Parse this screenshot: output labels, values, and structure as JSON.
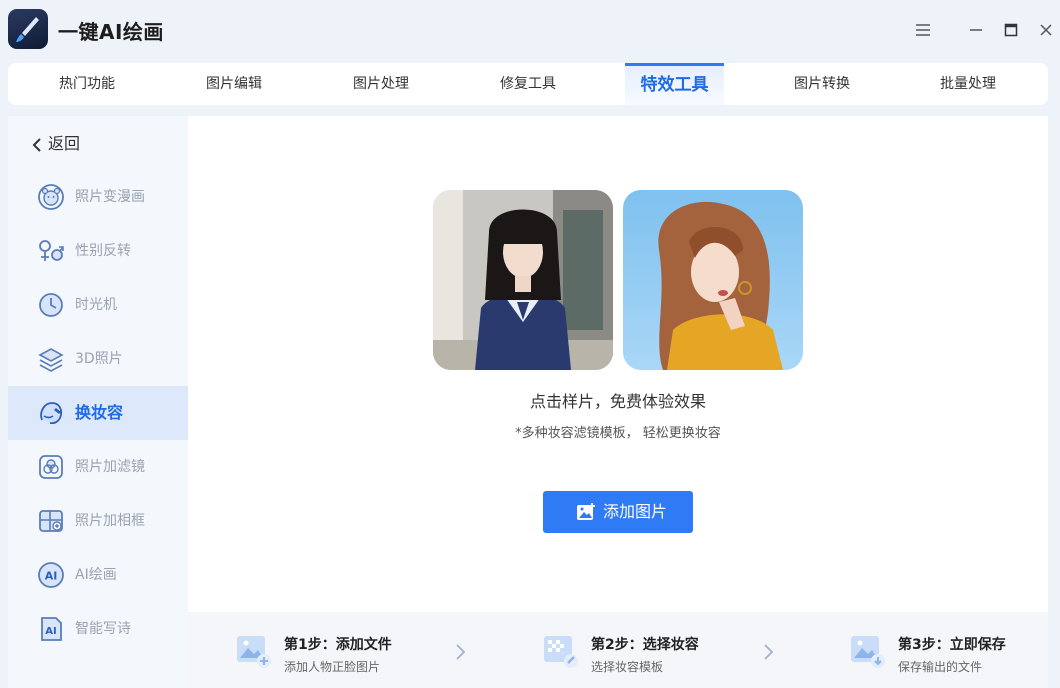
{
  "app": {
    "title": "一键AI绘画"
  },
  "tabs": [
    {
      "label": "热门功能"
    },
    {
      "label": "图片编辑"
    },
    {
      "label": "图片处理"
    },
    {
      "label": "修复工具"
    },
    {
      "label": "特效工具",
      "active": true
    },
    {
      "label": "图片转换"
    },
    {
      "label": "批量处理"
    }
  ],
  "sidebar": {
    "back_label": "返回",
    "items": [
      {
        "label": "照片变漫画",
        "icon": "bear-face-icon"
      },
      {
        "label": "性别反转",
        "icon": "gender-icon"
      },
      {
        "label": "时光机",
        "icon": "clock-icon"
      },
      {
        "label": "3D照片",
        "icon": "layers-icon"
      },
      {
        "label": "换妆容",
        "icon": "makeup-face-icon",
        "active": true
      },
      {
        "label": "照片加滤镜",
        "icon": "filter-icon"
      },
      {
        "label": "照片加相框",
        "icon": "frame-icon"
      },
      {
        "label": "AI绘画",
        "icon": "ai-circle-icon"
      },
      {
        "label": "智能写诗",
        "icon": "ai-doc-icon"
      }
    ]
  },
  "main": {
    "hint_title": "点击样片，免费体验效果",
    "hint_sub": "*多种妆容滤镜模板，  轻松更换妆容",
    "add_button": "添加图片"
  },
  "steps": [
    {
      "title": "第1步：添加文件",
      "desc": "添加人物正脸图片"
    },
    {
      "title": "第2步：选择妆容",
      "desc": "选择妆容模板"
    },
    {
      "title": "第3步：立即保存",
      "desc": "保存输出的文件"
    }
  ],
  "colors": {
    "accent": "#2f7bf6",
    "active_bg": "#dde8fb",
    "page_bg": "#eef2f9"
  }
}
